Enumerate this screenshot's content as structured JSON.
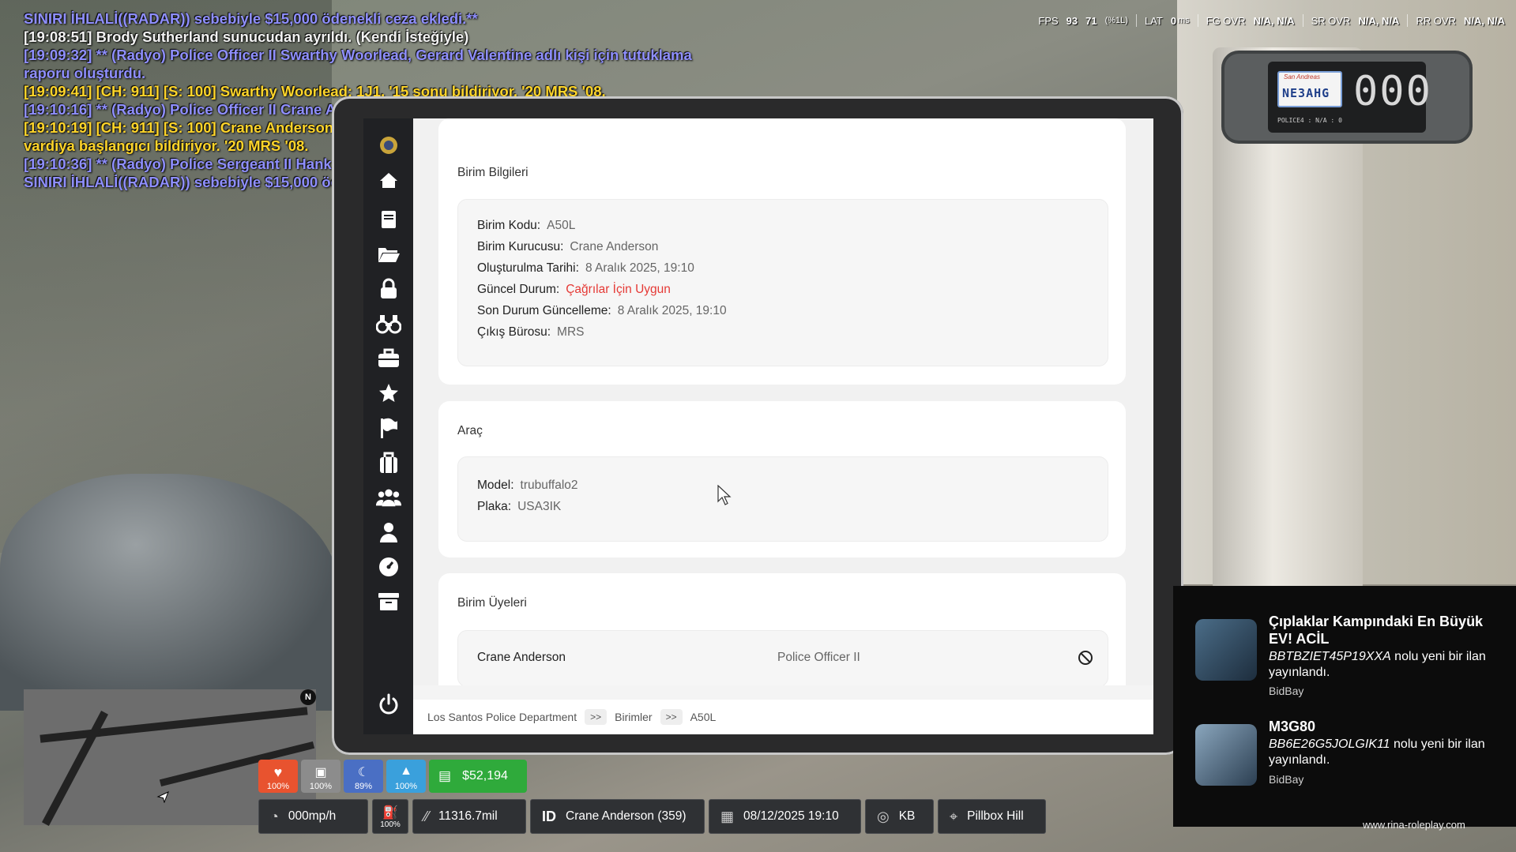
{
  "chat": {
    "lines": [
      {
        "text": "SINIRI İHLALİ((RADAR)) sebebiyle $15,000 ödenekli ceza ekledi.**",
        "kind": "radio"
      },
      {
        "text": "[19:08:51] Brody Sutherland sunucudan ayrıldı. (Kendi İsteğiyle)",
        "kind": "white"
      },
      {
        "text": "[19:09:32] ** (Radyo) Police Officer II Swarthy Woorlead, Gerard Valentine adlı kişi için tutuklama",
        "kind": "radio"
      },
      {
        "text": "raporu oluşturdu.",
        "kind": "radio"
      },
      {
        "text": "[19:09:41] [CH: 911] [S: 100] Swarthy Woorlead: 1J1, '15 sonu bildiriyor. '20 MRS '08.",
        "kind": "911"
      },
      {
        "text": "[19:10:16] ** (Radyo) Police Officer II Crane Anderson, A50L kodunda birim kurdu. (MRS) **",
        "kind": "radio"
      },
      {
        "text": "[19:10:19] [CH: 911] [S: 100] Crane Anderson: A50L, Memur Anderson belirtilen birim kodu altında",
        "kind": "911"
      },
      {
        "text": "vardiya başlangıcı bildiriyor. '20 MRS '08.",
        "kind": "911"
      },
      {
        "text": "[19:10:36] ** (Radyo) Police Sergeant II Hank Robertson, YUSHKVA (bmw21m5) model araç için HIZ",
        "kind": "radio"
      },
      {
        "text": "SINIRI İHLALİ((RADAR)) sebebiyle $15,000 ödenekli ceza ekledi.**",
        "kind": "radio"
      }
    ]
  },
  "perf": {
    "fps_label": "FPS",
    "fps": "93",
    "fps_low": "71",
    "fps_low_suffix": "(%1L)",
    "lat_label": "LAT",
    "lat": "0",
    "lat_unit": "ms",
    "fg_label": "FG OVR",
    "fg": "N/A,  N/A",
    "sr_label": "SR OVR",
    "sr": "N/A,  N/A",
    "rr_label": "RR OVR",
    "rr": "N/A,  N/A"
  },
  "radar": {
    "plate_state": "San Andreas",
    "plate": "NE3AHG",
    "speed": "000",
    "label": "POLICE4 : N/A : 0"
  },
  "unit_info": {
    "title": "Birim Bilgileri",
    "rows": [
      {
        "k": "Birim Kodu:",
        "v": "A50L"
      },
      {
        "k": "Birim Kurucusu:",
        "v": "Crane Anderson"
      },
      {
        "k": "Oluşturulma Tarihi:",
        "v": "8 Aralık 2025, 19:10"
      },
      {
        "k": "Güncel Durum:",
        "v": "Çağrılar İçin Uygun"
      },
      {
        "k": "Son Durum Güncelleme:",
        "v": "8 Aralık 2025, 19:10"
      },
      {
        "k": "Çıkış Bürosu:",
        "v": "MRS"
      }
    ]
  },
  "vehicle": {
    "title": "Araç",
    "model_k": "Model:",
    "model_v": "trubuffalo2",
    "plate_k": "Plaka:",
    "plate_v": "USA3IK"
  },
  "members": {
    "title": "Birim Üyeleri",
    "rows": [
      {
        "name": "Crane Anderson",
        "rank": "Police Officer II"
      }
    ]
  },
  "breadcrumb": {
    "a": "Los Santos Police Department",
    "sep": ">>",
    "b": "Birimler",
    "c": "A50L"
  },
  "status": {
    "health": "100%",
    "armor": "100%",
    "hunger": "89%",
    "thirst": "100%",
    "money": "$52,194",
    "colors": {
      "health": "#e8532f",
      "armor": "#8c8c8c",
      "hunger": "#4a6fc4",
      "thirst": "#3aa0dc",
      "money": "#2faa3b"
    }
  },
  "info_bar": {
    "speed": "000mp/h",
    "fuel": "100%",
    "odometer": "11316.7mil",
    "id_label": "ID",
    "player": "Crane Anderson (359)",
    "datetime": "08/12/2025 19:10",
    "direction": "KB",
    "location": "Pillbox Hill"
  },
  "notifications": [
    {
      "title": "Çıplaklar Kampındaki En Büyük EV! ACİL",
      "code": "BBTBZIET45P19XXA",
      "text": " nolu yeni bir ilan yayınlandı.",
      "source": "BidBay"
    },
    {
      "title": "M3G80",
      "code": "BB6E26G5JOLGIK11",
      "text": " nolu yeni bir ilan yayınlandı.",
      "source": "BidBay"
    }
  ],
  "watermark": "www.rina-roleplay.com",
  "minimap": {
    "badge": "N"
  }
}
